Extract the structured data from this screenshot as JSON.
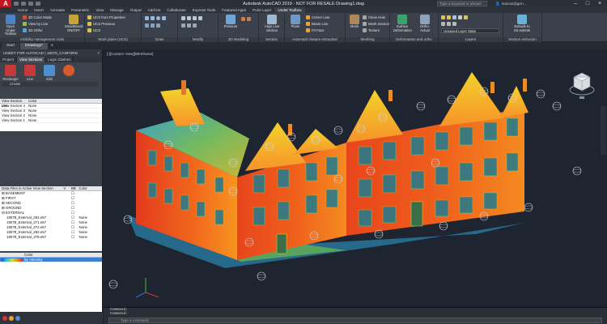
{
  "window": {
    "title": "Autodesk AutoCAD 2019 - NOT FOR RESALE    Drawing1.dwg",
    "logo_letter": "A",
    "search_placeholder": "Type a keyword or phrase",
    "user_name": "marcus@grm..."
  },
  "ribbon_tabs": [
    "Home",
    "Insert",
    "Annotate",
    "Parametric",
    "View",
    "Manage",
    "Output",
    "Add-ins",
    "Collaborate",
    "Express Tools",
    "Featured Apps",
    "Point Layer",
    "Undet Toolbox"
  ],
  "active_ribbon_tab": 12,
  "ribbon": {
    "p1": {
      "title": "Visibility management tools",
      "btn1": "Open Undet Toolbox",
      "row1": "3D Color Mode",
      "row2": "View by Line",
      "row3": "3D Ortho",
      "btn2": "SmartBoard ON/OFF"
    },
    "p2": {
      "title": "Work plane (UCS)",
      "row1": "UCS from Properties",
      "row2": "UCS Previous",
      "row3": "UCS"
    },
    "p3": {
      "title": "Draw"
    },
    "p4": {
      "title": "Modify"
    },
    "p5": {
      "title": "3D Modeling",
      "btn1": "Pressure"
    },
    "p6": {
      "title": "Section",
      "btn1": "Align Live Section"
    },
    "p7": {
      "title": "Automatic feature extraction",
      "btn1": "Plane",
      "row1": "Corner Line",
      "row2": "Beam Line",
      "row3": "Fit Face"
    },
    "p8": {
      "title": "Meshing",
      "btn1": "Mesh",
      "row1": "Close Hole",
      "row2": "Mesh Section",
      "row3": "Texture"
    },
    "p9": {
      "title": "Deformation and ortho",
      "btn1": "Surface Deformation",
      "btn2": "Ortho-Actual"
    },
    "p10": {
      "title": "Layers",
      "row1": "Unsaved Layer State"
    },
    "p11": {
      "title": "Section extrusion",
      "btn1": "Extrude to SS extents"
    }
  },
  "file_tabs": [
    "Start",
    "Drawing1*"
  ],
  "active_file_tab": 1,
  "left_panel": {
    "header": "UNDET FOR AUTOCAD | 18078_CANFORD",
    "tabs": [
      "Project",
      "View Sections",
      "Logic Clashes"
    ],
    "active_tab": 1,
    "tools": [
      "Rectangle",
      "Line",
      "Edit",
      ""
    ],
    "create_label": "Create",
    "section_list": {
      "headers": [
        "View Section List",
        "Color"
      ],
      "rows": [
        [
          "View Section 4",
          "None"
        ],
        [
          "View Section 3",
          "None"
        ],
        [
          "View Section 2",
          "None"
        ],
        [
          "View Section 1",
          "None"
        ]
      ]
    },
    "data_files": {
      "headers": [
        "Data Files in Active View Section",
        "V",
        "BB",
        "Color"
      ],
      "rows": [
        [
          "⊞ BASEMENT",
          "",
          "☐",
          ""
        ],
        [
          "⊞ FIRST",
          "",
          "☐",
          ""
        ],
        [
          "⊞ SECOND",
          "",
          "☐",
          ""
        ],
        [
          "⊞ GROUND",
          "",
          "☐",
          ""
        ],
        [
          "⊟ EXTERNAL",
          "",
          "☐",
          ""
        ],
        [
          "18078_External_281.e57",
          "",
          "☐",
          "None"
        ],
        [
          "18078_External_271.e57",
          "",
          "☐",
          "None"
        ],
        [
          "18078_External_272.e57",
          "",
          "☐",
          "None"
        ],
        [
          "18078_External_282.e57",
          "",
          "☐",
          "None"
        ],
        [
          "18078_External_278.e57",
          "",
          "☐",
          "None"
        ]
      ]
    },
    "color_list": {
      "headers": [
        "",
        "Color"
      ],
      "rows": [
        [
          "",
          "By Intensity"
        ]
      ]
    }
  },
  "viewport": {
    "label": "[-][Custom View][Wireframe]"
  },
  "command": {
    "lines": [
      "Command:",
      "Command:"
    ],
    "placeholder": "Type a command"
  },
  "colors": {
    "accent": "#c4161c",
    "selection": "#3b7fd0",
    "background": "#1e2530"
  }
}
